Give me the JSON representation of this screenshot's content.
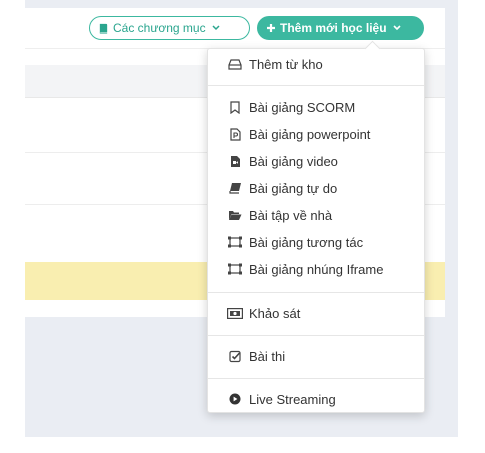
{
  "toolbar": {
    "categories_label": "Các chương mục",
    "add_label": "Thêm mới học liệu"
  },
  "menu": {
    "items": [
      {
        "label": "Thêm từ kho",
        "icon": "hdd-icon"
      },
      {
        "label": "Bài giảng SCORM",
        "icon": "bookmark-icon"
      },
      {
        "label": "Bài giảng powerpoint",
        "icon": "powerpoint-file-icon"
      },
      {
        "label": "Bài giảng video",
        "icon": "video-file-icon"
      },
      {
        "label": "Bài giảng tự do",
        "icon": "book-icon"
      },
      {
        "label": "Bài tập về nhà",
        "icon": "folder-open-icon"
      },
      {
        "label": "Bài giảng tương tác",
        "icon": "interactive-icon"
      },
      {
        "label": "Bài giảng nhúng Iframe",
        "icon": "iframe-icon"
      },
      {
        "label": "Khảo sát",
        "icon": "survey-icon"
      },
      {
        "label": "Bài thi",
        "icon": "check-square-icon"
      },
      {
        "label": "Live Streaming",
        "icon": "play-circle-icon"
      }
    ]
  },
  "colors": {
    "accent": "#3cb8a0",
    "highlight_row": "#f9eeb0",
    "page_bg": "#eaedf3"
  }
}
